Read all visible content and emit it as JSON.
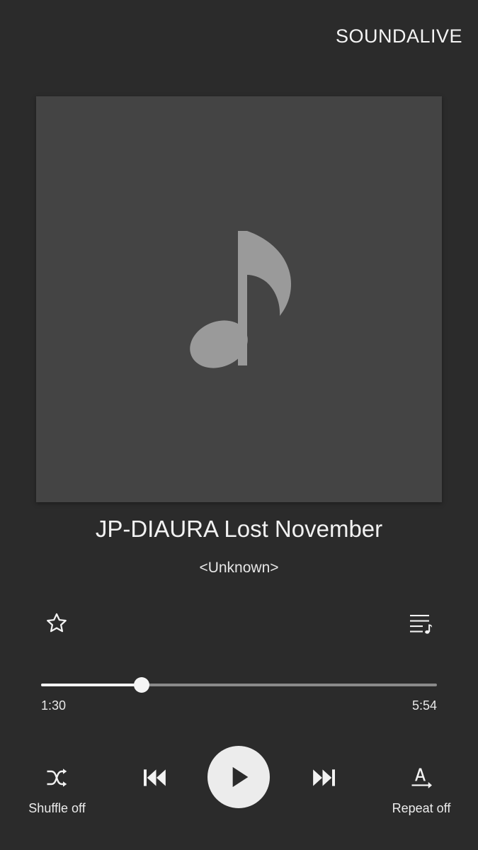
{
  "header": {
    "soundalive_label": "SOUNDALIVE"
  },
  "album_art": {
    "icon": "music-note-icon"
  },
  "track": {
    "title": "JP-DIAURA Lost November",
    "artist": "<Unknown>"
  },
  "actions": {
    "favorite_icon": "star-outline-icon",
    "playlist_icon": "playlist-music-icon"
  },
  "playback": {
    "elapsed": "1:30",
    "total": "5:54",
    "progress_fraction": 0.254
  },
  "controls": {
    "shuffle_label": "Shuffle off",
    "shuffle_icon": "shuffle-icon",
    "previous_icon": "skip-previous-icon",
    "play_icon": "play-icon",
    "next_icon": "skip-next-icon",
    "repeat_label": "Repeat off",
    "repeat_icon": "repeat-off-icon"
  },
  "colors": {
    "background": "#2b2b2b",
    "art_background": "#444444",
    "note": "#9a9a9a",
    "accent": "#f5f5f5"
  }
}
